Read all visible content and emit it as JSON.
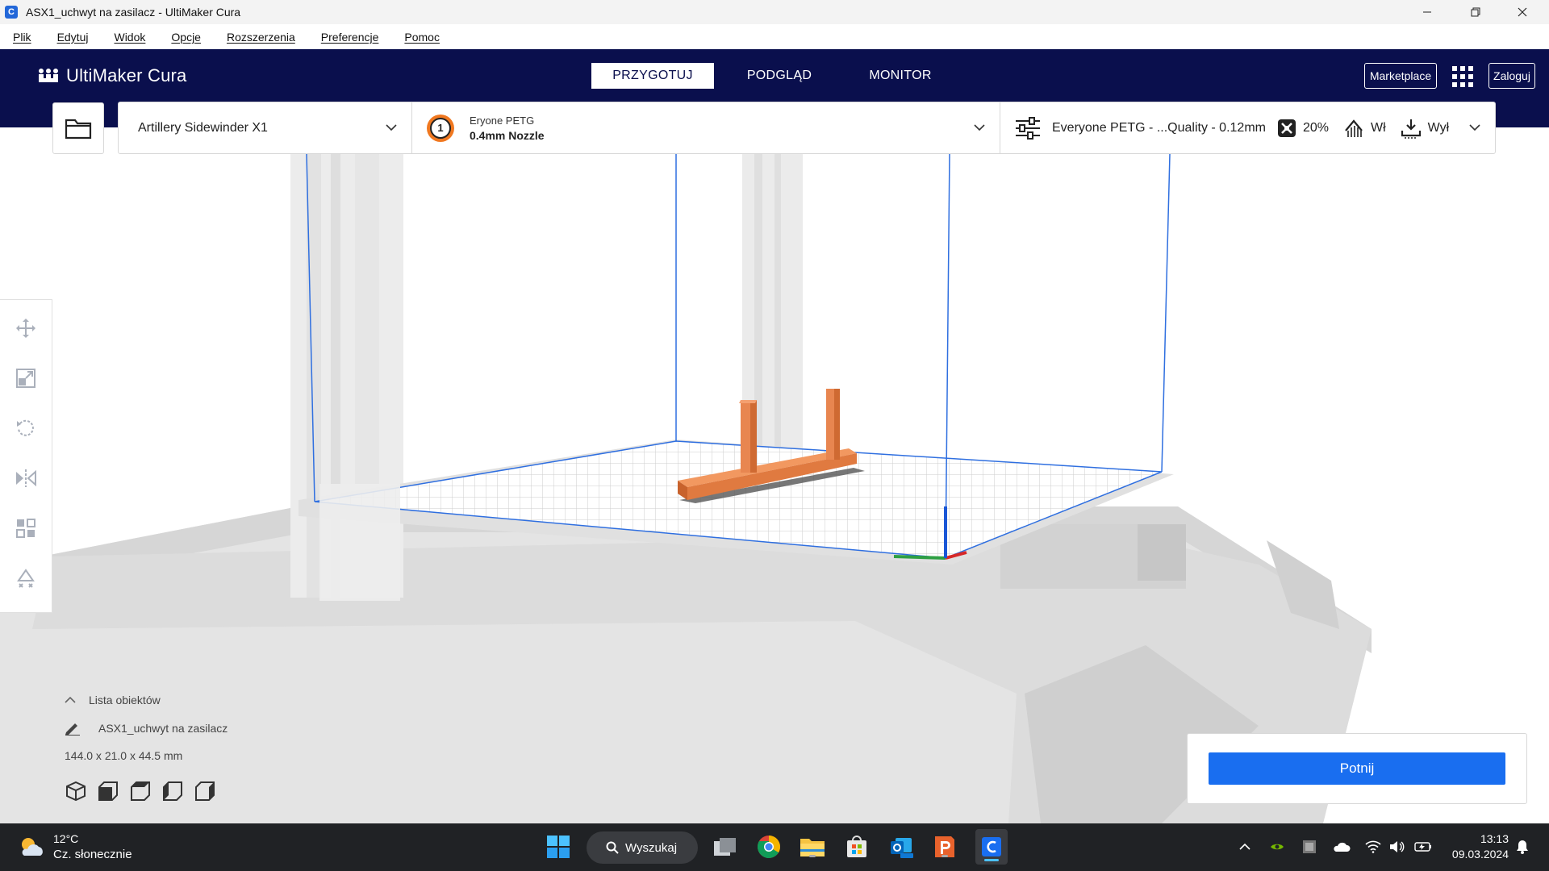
{
  "window": {
    "title": "ASX1_uchwyt na zasilacz - UltiMaker Cura",
    "app_icon_glyph": "C"
  },
  "menu": [
    "Plik",
    "Edytuj",
    "Widok",
    "Opcje",
    "Rozszerzenia",
    "Preferencje",
    "Pomoc"
  ],
  "header": {
    "brand": "UltiMaker Cura",
    "tabs": [
      {
        "label": "PRZYGOTUJ",
        "active": true
      },
      {
        "label": "PODGLĄD",
        "active": false
      },
      {
        "label": "MONITOR",
        "active": false
      }
    ],
    "marketplace_label": "Marketplace",
    "login_label": "Zaloguj"
  },
  "config": {
    "printer": "Artillery Sidewinder X1",
    "extruder_number": "1",
    "material": "Eryone PETG",
    "nozzle": "0.4mm Nozzle",
    "profile": "Everyone PETG - ...Quality - 0.12mm",
    "infill": "20%",
    "support": "Wł",
    "adhesion": "Wył"
  },
  "object_list": {
    "header": "Lista obiektów",
    "item": "ASX1_uchwyt na zasilacz",
    "dimensions": "144.0 x 21.0 x 44.5 mm"
  },
  "slice": {
    "button_label": "Potnij"
  },
  "taskbar": {
    "temperature": "12°C",
    "weather": "Cz. słonecznie",
    "search_label": "Wyszukaj",
    "time": "13:13",
    "date": "09.03.2024"
  },
  "colors": {
    "header_bg": "#0a0f4d",
    "accent_blue": "#196ef0",
    "model_orange": "#e8824a",
    "build_volume_line": "#2f6fe0",
    "taskbar_bg": "#202225"
  }
}
